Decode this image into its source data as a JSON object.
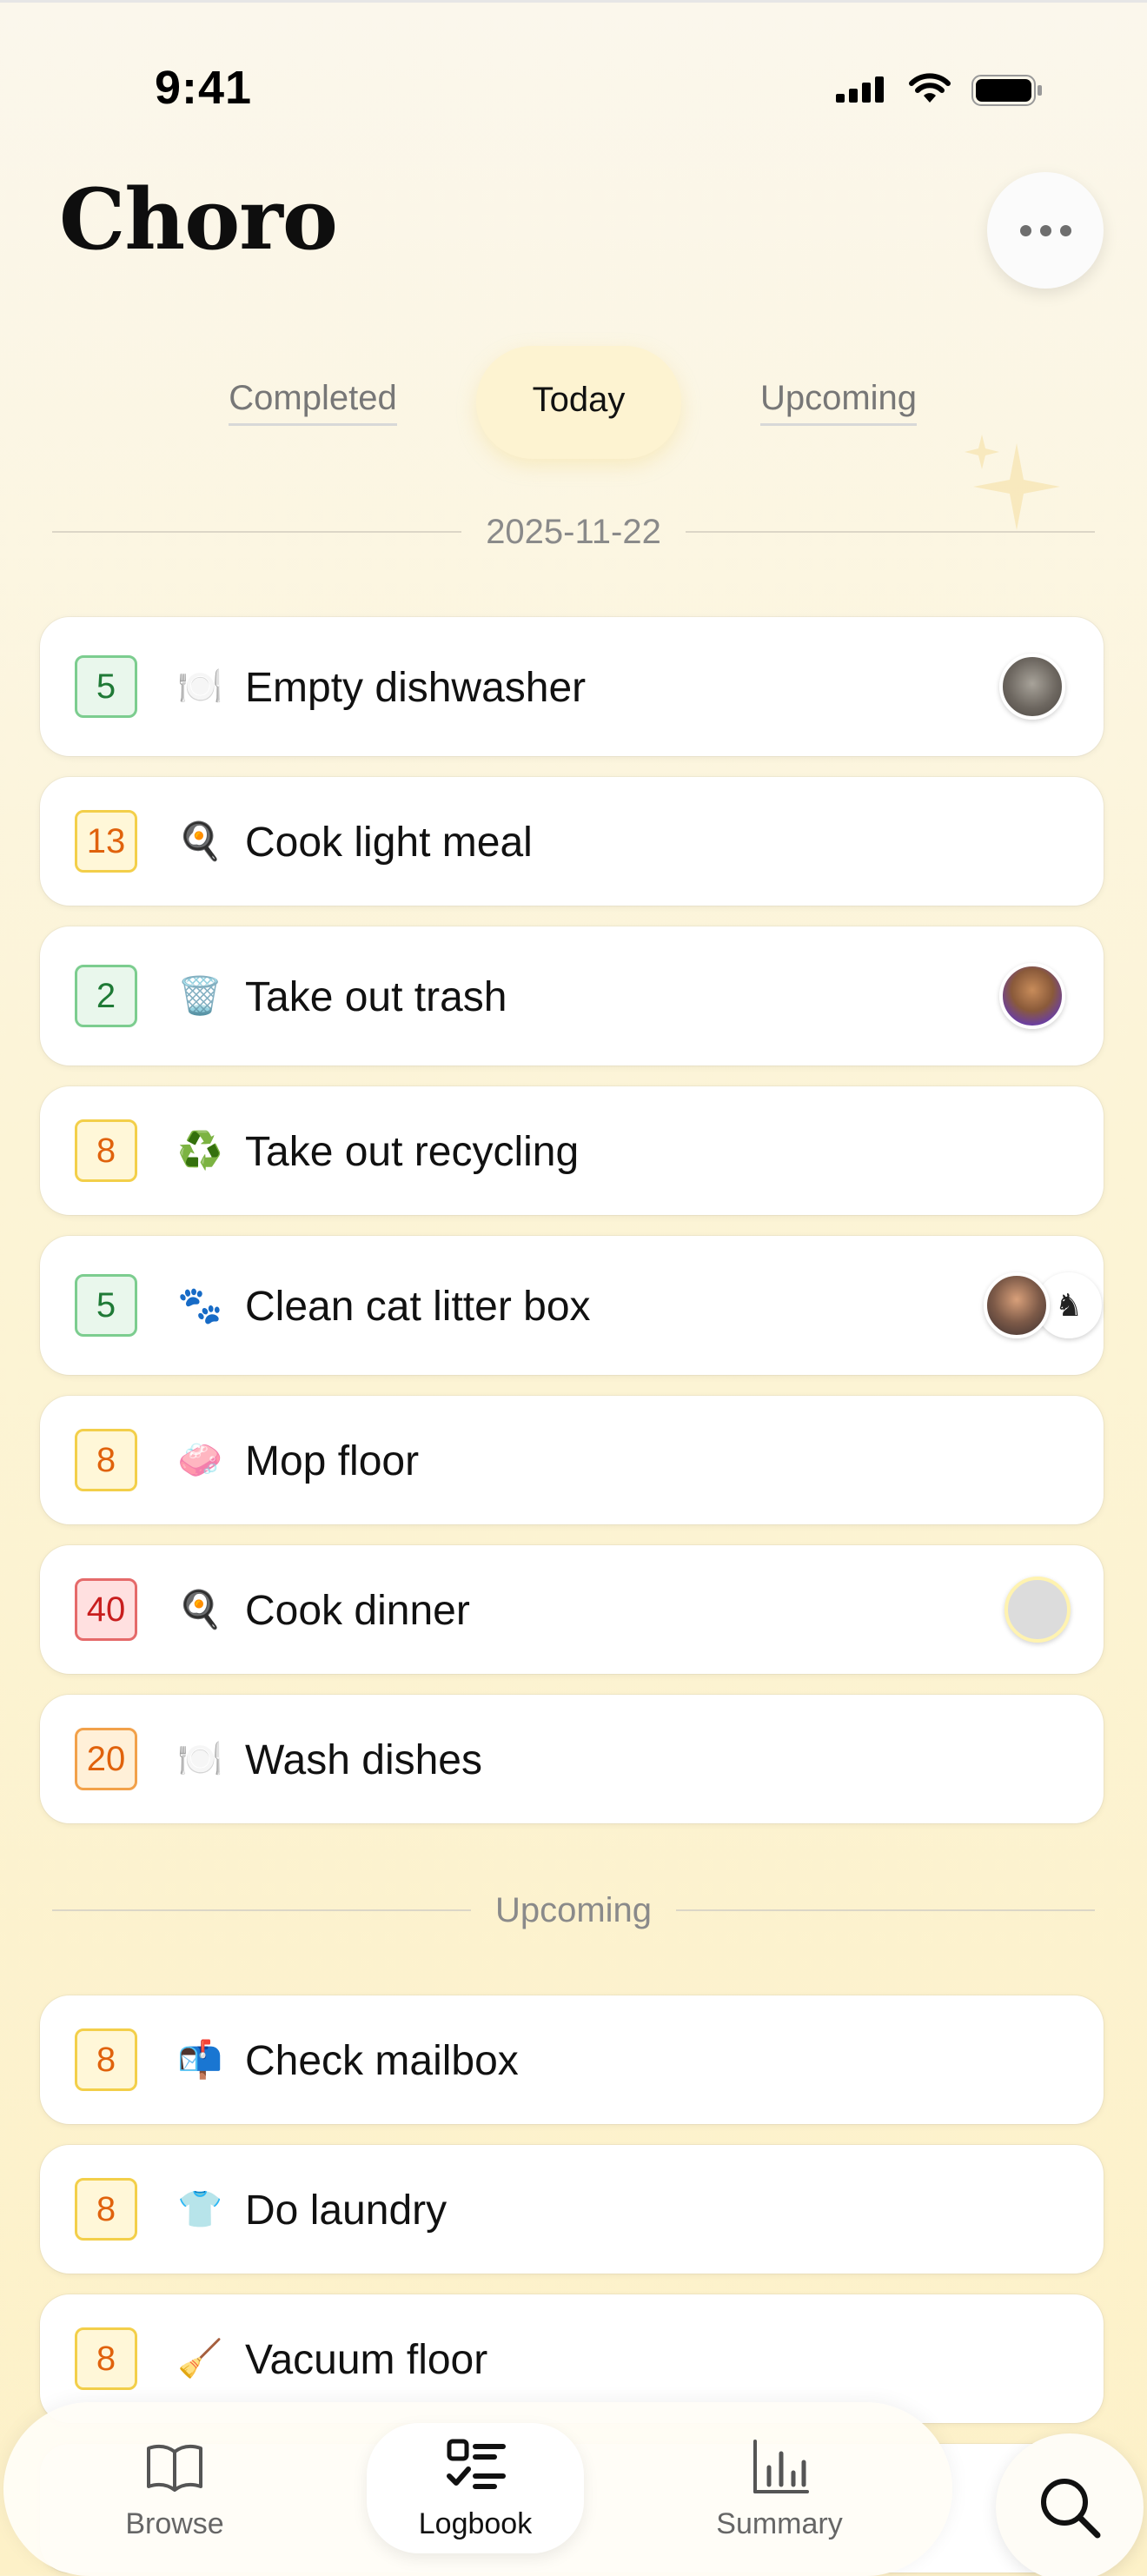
{
  "status_bar": {
    "time": "9:41"
  },
  "header": {
    "title": "Choro"
  },
  "tabs": [
    {
      "label": "Completed"
    },
    {
      "label": "Today",
      "active": true
    },
    {
      "label": "Upcoming"
    }
  ],
  "sections": {
    "today_date": "2025-11-22",
    "upcoming_label": "Upcoming"
  },
  "today_chores": [
    {
      "points": "5",
      "badge_color": "green",
      "emoji": "🍽️",
      "icon": "plate-icon",
      "title": "Empty dishwasher",
      "avatars": [
        "portrait"
      ]
    },
    {
      "points": "13",
      "badge_color": "yellow",
      "emoji": "🍳",
      "icon": "frying-pan-icon",
      "title": "Cook light meal",
      "avatars": []
    },
    {
      "points": "2",
      "badge_color": "green",
      "emoji": "🗑️",
      "icon": "trash-can-icon",
      "title": "Take out trash",
      "avatars": [
        "cartoon"
      ]
    },
    {
      "points": "8",
      "badge_color": "yellow",
      "emoji": "♻️",
      "icon": "recycle-icon",
      "title": "Take out recycling",
      "avatars": []
    },
    {
      "points": "5",
      "badge_color": "green",
      "emoji": "🐾",
      "icon": "paw-icon",
      "title": "Clean cat litter box",
      "avatars": [
        "person",
        "drawing"
      ]
    },
    {
      "points": "8",
      "badge_color": "yellow",
      "emoji": "🧼",
      "icon": "soap-icon",
      "title": "Mop floor",
      "avatars": []
    },
    {
      "points": "40",
      "badge_color": "red",
      "emoji": "🍳",
      "icon": "frying-pan-icon",
      "title": "Cook dinner",
      "avatars": [
        "empty"
      ]
    },
    {
      "points": "20",
      "badge_color": "orange",
      "emoji": "🍽️",
      "icon": "plate-icon",
      "title": "Wash dishes",
      "avatars": []
    }
  ],
  "upcoming_chores": [
    {
      "points": "8",
      "badge_color": "yellow",
      "emoji": "📬",
      "icon": "mailbox-icon",
      "title": "Check mailbox"
    },
    {
      "points": "8",
      "badge_color": "yellow",
      "emoji": "👕",
      "icon": "shirt-icon",
      "title": "Do laundry"
    },
    {
      "points": "8",
      "badge_color": "yellow",
      "emoji": "🧹",
      "icon": "broom-icon",
      "title": "Vacuum floor"
    }
  ],
  "bottom_nav": [
    {
      "label": "Browse",
      "icon": "book-icon"
    },
    {
      "label": "Logbook",
      "icon": "checklist-icon",
      "active": true
    },
    {
      "label": "Summary",
      "icon": "bar-chart-icon"
    }
  ],
  "colors": {
    "badge_green": "#7ccd8f",
    "badge_yellow": "#f3cf4a",
    "badge_orange": "#f2a14a",
    "badge_red": "#e56a6a",
    "background": "#fcf4d6"
  }
}
